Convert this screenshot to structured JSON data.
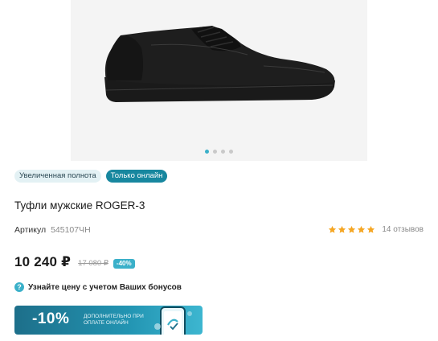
{
  "gallery": {
    "image_alt": "shoe-image",
    "dots": [
      {
        "active": true
      },
      {
        "active": false
      },
      {
        "active": false
      },
      {
        "active": false
      }
    ]
  },
  "badges": [
    {
      "label": "Увеличенная полнота",
      "style": "light"
    },
    {
      "label": "Только онлайн",
      "style": "dark"
    }
  ],
  "product": {
    "title": "Туфли мужские ROGER-3",
    "sku_label": "Артикул",
    "sku_value": "545107ЧН"
  },
  "rating": {
    "stars": 5,
    "reviews": "14 отзывов",
    "star_color": "#f5a623"
  },
  "price": {
    "current": "10 240 ₽",
    "old": "17 080 ₽",
    "discount": "-40%"
  },
  "bonus": {
    "icon": "?",
    "text": "Узнайте цену с учетом Ваших бонусов"
  },
  "promo": {
    "percent": "-10%",
    "text": "дополнительно при оплате онлайн"
  },
  "colors": {
    "accent": "#3ab0c9",
    "badge_dark": "#17879f",
    "badge_light": "#e3f1f4"
  }
}
